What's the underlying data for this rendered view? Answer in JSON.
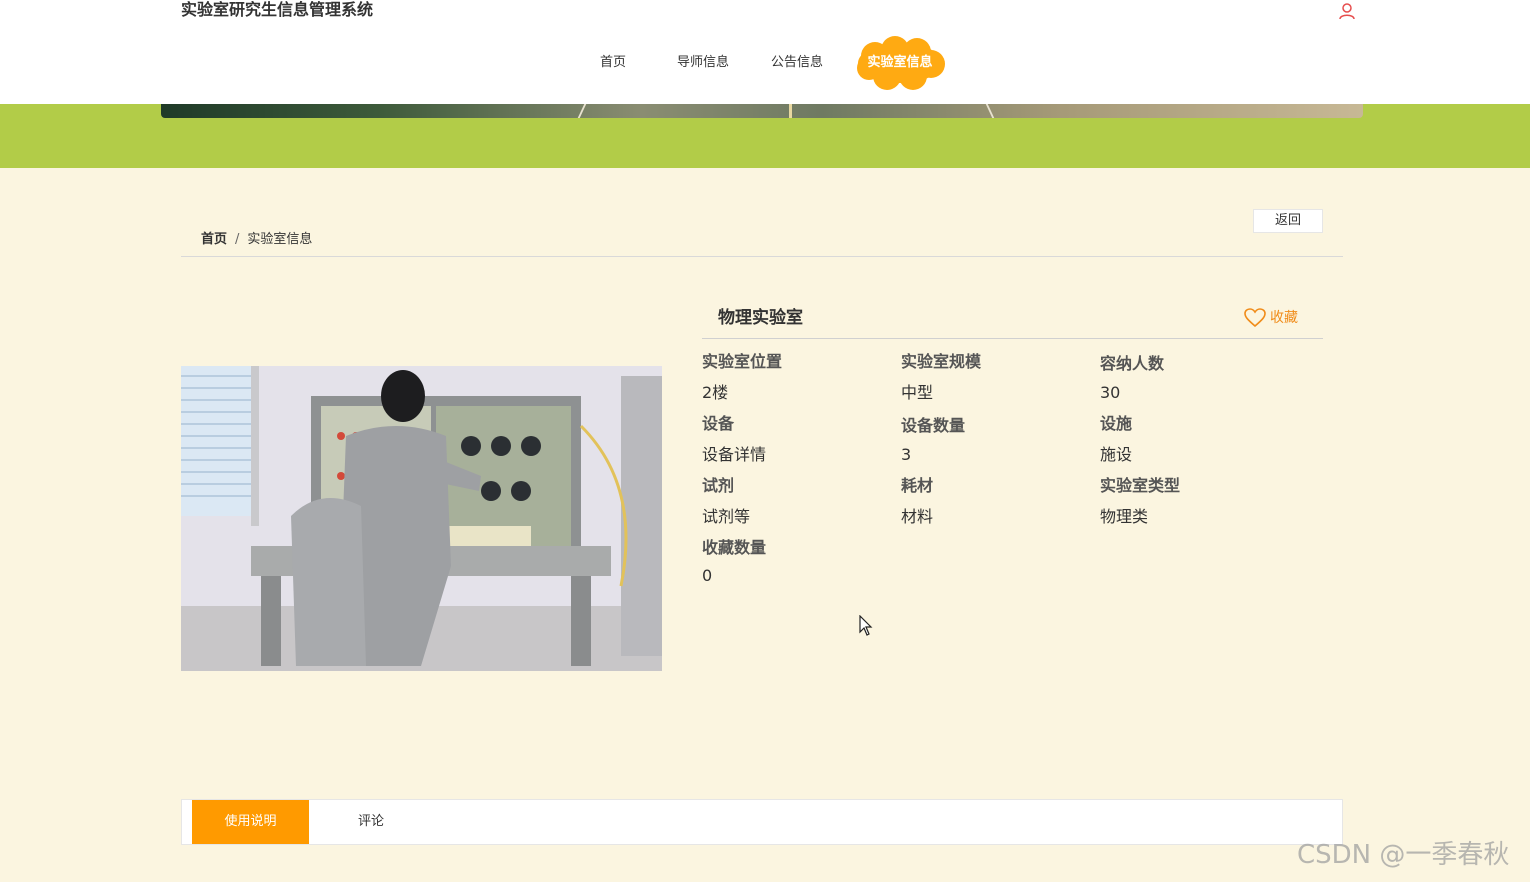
{
  "header": {
    "site_title": "实验室研究生信息管理系统",
    "nav": [
      {
        "label": "首页"
      },
      {
        "label": "导师信息"
      },
      {
        "label": "公告信息"
      },
      {
        "label": "实验室信息",
        "active": true
      }
    ],
    "user_icon": "user-icon"
  },
  "breadcrumb": {
    "home": "首页",
    "separator": "/",
    "current": "实验室信息"
  },
  "back_button": "返回",
  "detail": {
    "title": "物理实验室",
    "favorite_label": "收藏",
    "favorite_icon": "heart-icon",
    "fields": [
      {
        "label": "实验室位置",
        "value": "2楼"
      },
      {
        "label": "实验室规模",
        "value": "中型"
      },
      {
        "label": "容纳人数",
        "value": "30"
      },
      {
        "label": "设备",
        "value": "设备详情"
      },
      {
        "label": "设备数量",
        "value": "3"
      },
      {
        "label": "设施",
        "value": "施设"
      },
      {
        "label": "试剂",
        "value": "试剂等"
      },
      {
        "label": "耗材",
        "value": "材料"
      },
      {
        "label": "实验室类型",
        "value": "物理类"
      },
      {
        "label": "收藏数量",
        "value": "0"
      }
    ]
  },
  "tabs": {
    "active": "使用说明",
    "other": "评论"
  },
  "watermark": "CSDN @一季春秋",
  "colors": {
    "accent": "#ff9a00",
    "banner_green": "#b2cc48",
    "page_bg": "#fbf5e0",
    "favorite": "#f08c1a"
  }
}
